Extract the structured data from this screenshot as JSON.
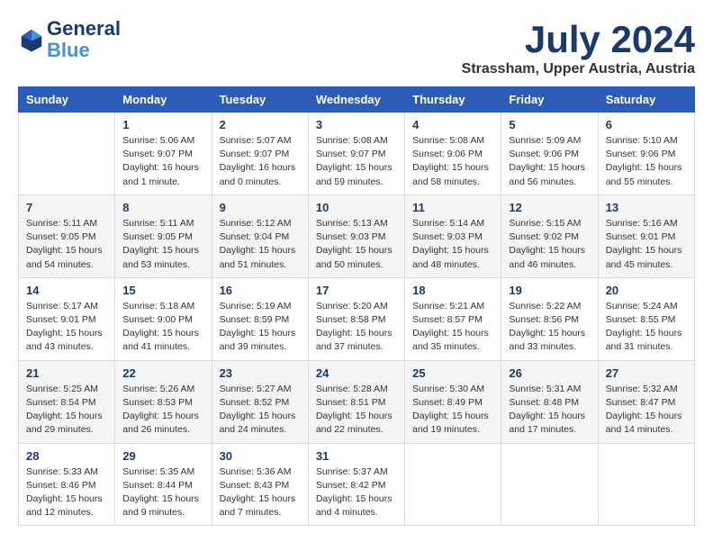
{
  "header": {
    "logo_line1": "General",
    "logo_line2": "Blue",
    "month": "July 2024",
    "location": "Strassham, Upper Austria, Austria"
  },
  "columns": [
    "Sunday",
    "Monday",
    "Tuesday",
    "Wednesday",
    "Thursday",
    "Friday",
    "Saturday"
  ],
  "weeks": [
    [
      {
        "day": "",
        "info": ""
      },
      {
        "day": "1",
        "info": "Sunrise: 5:06 AM\nSunset: 9:07 PM\nDaylight: 16 hours\nand 1 minute."
      },
      {
        "day": "2",
        "info": "Sunrise: 5:07 AM\nSunset: 9:07 PM\nDaylight: 16 hours\nand 0 minutes."
      },
      {
        "day": "3",
        "info": "Sunrise: 5:08 AM\nSunset: 9:07 PM\nDaylight: 15 hours\nand 59 minutes."
      },
      {
        "day": "4",
        "info": "Sunrise: 5:08 AM\nSunset: 9:06 PM\nDaylight: 15 hours\nand 58 minutes."
      },
      {
        "day": "5",
        "info": "Sunrise: 5:09 AM\nSunset: 9:06 PM\nDaylight: 15 hours\nand 56 minutes."
      },
      {
        "day": "6",
        "info": "Sunrise: 5:10 AM\nSunset: 9:06 PM\nDaylight: 15 hours\nand 55 minutes."
      }
    ],
    [
      {
        "day": "7",
        "info": "Sunrise: 5:11 AM\nSunset: 9:05 PM\nDaylight: 15 hours\nand 54 minutes."
      },
      {
        "day": "8",
        "info": "Sunrise: 5:11 AM\nSunset: 9:05 PM\nDaylight: 15 hours\nand 53 minutes."
      },
      {
        "day": "9",
        "info": "Sunrise: 5:12 AM\nSunset: 9:04 PM\nDaylight: 15 hours\nand 51 minutes."
      },
      {
        "day": "10",
        "info": "Sunrise: 5:13 AM\nSunset: 9:03 PM\nDaylight: 15 hours\nand 50 minutes."
      },
      {
        "day": "11",
        "info": "Sunrise: 5:14 AM\nSunset: 9:03 PM\nDaylight: 15 hours\nand 48 minutes."
      },
      {
        "day": "12",
        "info": "Sunrise: 5:15 AM\nSunset: 9:02 PM\nDaylight: 15 hours\nand 46 minutes."
      },
      {
        "day": "13",
        "info": "Sunrise: 5:16 AM\nSunset: 9:01 PM\nDaylight: 15 hours\nand 45 minutes."
      }
    ],
    [
      {
        "day": "14",
        "info": "Sunrise: 5:17 AM\nSunset: 9:01 PM\nDaylight: 15 hours\nand 43 minutes."
      },
      {
        "day": "15",
        "info": "Sunrise: 5:18 AM\nSunset: 9:00 PM\nDaylight: 15 hours\nand 41 minutes."
      },
      {
        "day": "16",
        "info": "Sunrise: 5:19 AM\nSunset: 8:59 PM\nDaylight: 15 hours\nand 39 minutes."
      },
      {
        "day": "17",
        "info": "Sunrise: 5:20 AM\nSunset: 8:58 PM\nDaylight: 15 hours\nand 37 minutes."
      },
      {
        "day": "18",
        "info": "Sunrise: 5:21 AM\nSunset: 8:57 PM\nDaylight: 15 hours\nand 35 minutes."
      },
      {
        "day": "19",
        "info": "Sunrise: 5:22 AM\nSunset: 8:56 PM\nDaylight: 15 hours\nand 33 minutes."
      },
      {
        "day": "20",
        "info": "Sunrise: 5:24 AM\nSunset: 8:55 PM\nDaylight: 15 hours\nand 31 minutes."
      }
    ],
    [
      {
        "day": "21",
        "info": "Sunrise: 5:25 AM\nSunset: 8:54 PM\nDaylight: 15 hours\nand 29 minutes."
      },
      {
        "day": "22",
        "info": "Sunrise: 5:26 AM\nSunset: 8:53 PM\nDaylight: 15 hours\nand 26 minutes."
      },
      {
        "day": "23",
        "info": "Sunrise: 5:27 AM\nSunset: 8:52 PM\nDaylight: 15 hours\nand 24 minutes."
      },
      {
        "day": "24",
        "info": "Sunrise: 5:28 AM\nSunset: 8:51 PM\nDaylight: 15 hours\nand 22 minutes."
      },
      {
        "day": "25",
        "info": "Sunrise: 5:30 AM\nSunset: 8:49 PM\nDaylight: 15 hours\nand 19 minutes."
      },
      {
        "day": "26",
        "info": "Sunrise: 5:31 AM\nSunset: 8:48 PM\nDaylight: 15 hours\nand 17 minutes."
      },
      {
        "day": "27",
        "info": "Sunrise: 5:32 AM\nSunset: 8:47 PM\nDaylight: 15 hours\nand 14 minutes."
      }
    ],
    [
      {
        "day": "28",
        "info": "Sunrise: 5:33 AM\nSunset: 8:46 PM\nDaylight: 15 hours\nand 12 minutes."
      },
      {
        "day": "29",
        "info": "Sunrise: 5:35 AM\nSunset: 8:44 PM\nDaylight: 15 hours\nand 9 minutes."
      },
      {
        "day": "30",
        "info": "Sunrise: 5:36 AM\nSunset: 8:43 PM\nDaylight: 15 hours\nand 7 minutes."
      },
      {
        "day": "31",
        "info": "Sunrise: 5:37 AM\nSunset: 8:42 PM\nDaylight: 15 hours\nand 4 minutes."
      },
      {
        "day": "",
        "info": ""
      },
      {
        "day": "",
        "info": ""
      },
      {
        "day": "",
        "info": ""
      }
    ]
  ]
}
